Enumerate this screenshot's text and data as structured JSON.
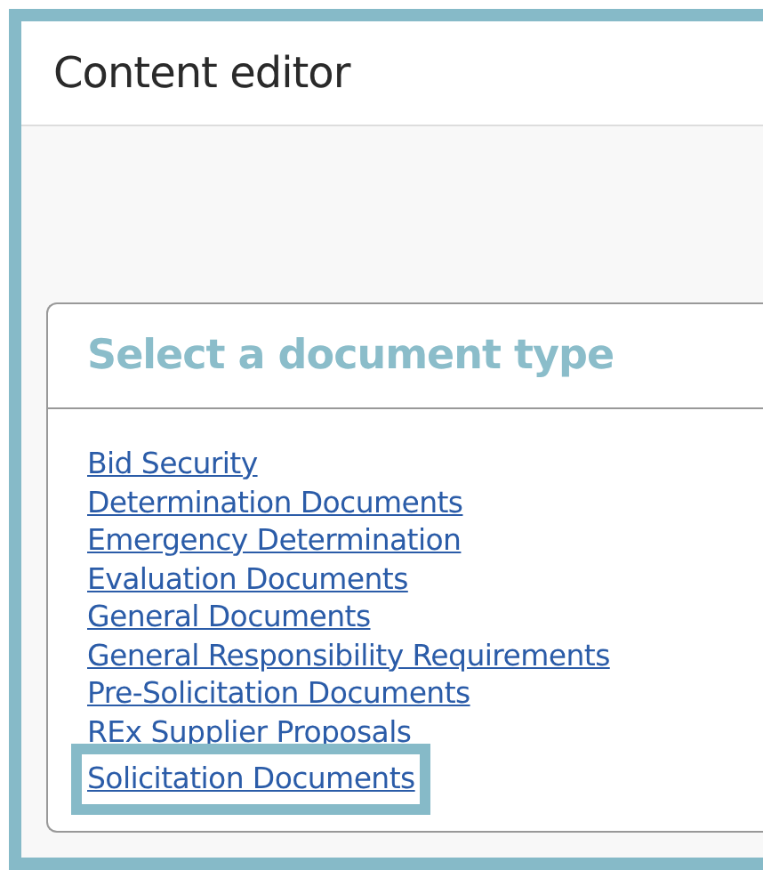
{
  "window": {
    "title": "Content editor"
  },
  "panel": {
    "title": "Select a document type",
    "items": [
      {
        "label": "Bid Security",
        "selected": false
      },
      {
        "label": "Determination Documents",
        "selected": false
      },
      {
        "label": "Emergency Determination",
        "selected": false
      },
      {
        "label": "Evaluation Documents",
        "selected": false
      },
      {
        "label": "General Documents",
        "selected": false
      },
      {
        "label": "General Responsibility Requirements",
        "selected": false
      },
      {
        "label": "Pre-Solicitation Documents",
        "selected": false
      },
      {
        "label": "REx Supplier Proposals",
        "selected": false
      },
      {
        "label": "Solicitation Documents",
        "selected": true
      }
    ]
  }
}
